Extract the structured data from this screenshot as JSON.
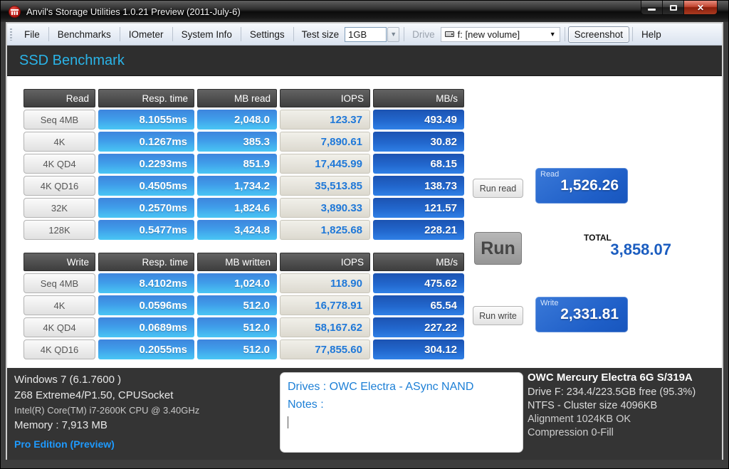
{
  "window": {
    "title": "Anvil's Storage Utilities 1.0.21 Preview (2011-July-6)"
  },
  "menu": {
    "items": [
      "File",
      "Benchmarks",
      "IOmeter",
      "System Info",
      "Settings"
    ],
    "test_size_label": "Test size",
    "test_size_value": "1GB",
    "drive_label": "Drive",
    "drive_value": "f: [new volume]",
    "screenshot_label": "Screenshot",
    "help_label": "Help"
  },
  "banner": {
    "title": "SSD Benchmark"
  },
  "read_table": {
    "headers": [
      "Read",
      "Resp. time",
      "MB read",
      "IOPS",
      "MB/s"
    ],
    "rows": [
      [
        "Seq 4MB",
        "8.1055ms",
        "2,048.0",
        "123.37",
        "493.49"
      ],
      [
        "4K",
        "0.1267ms",
        "385.3",
        "7,890.61",
        "30.82"
      ],
      [
        "4K QD4",
        "0.2293ms",
        "851.9",
        "17,445.99",
        "68.15"
      ],
      [
        "4K QD16",
        "0.4505ms",
        "1,734.2",
        "35,513.85",
        "138.73"
      ],
      [
        "32K",
        "0.2570ms",
        "1,824.6",
        "3,890.33",
        "121.57"
      ],
      [
        "128K",
        "0.5477ms",
        "3,424.8",
        "1,825.68",
        "228.21"
      ]
    ]
  },
  "write_table": {
    "headers": [
      "Write",
      "Resp. time",
      "MB written",
      "IOPS",
      "MB/s"
    ],
    "rows": [
      [
        "Seq 4MB",
        "8.4102ms",
        "1,024.0",
        "118.90",
        "475.62"
      ],
      [
        "4K",
        "0.0596ms",
        "512.0",
        "16,778.91",
        "65.54"
      ],
      [
        "4K QD4",
        "0.0689ms",
        "512.0",
        "58,167.62",
        "227.22"
      ],
      [
        "4K QD16",
        "0.2055ms",
        "512.0",
        "77,855.60",
        "304.12"
      ]
    ]
  },
  "actions": {
    "run_read": "Run read",
    "run": "Run",
    "run_write": "Run write"
  },
  "scores": {
    "read_label": "Read",
    "read_value": "1,526.26",
    "total_label": "TOTAL",
    "total_value": "3,858.07",
    "write_label": "Write",
    "write_value": "2,331.81"
  },
  "footer": {
    "system": {
      "os": "Windows 7 (6.1.7600 )",
      "board": "Z68 Extreme4/P1.50, CPUSocket",
      "cpu": "Intel(R) Core(TM) i7-2600K CPU @ 3.40GHz",
      "memory": "Memory : 7,913 MB",
      "edition": "Pro Edition (Preview)"
    },
    "notes": {
      "drives_line": "Drives : OWC Electra - ASync NAND",
      "notes_line": "Notes :"
    },
    "drive": {
      "model": "OWC Mercury Electra 6G S/319A",
      "capacity": "Drive F: 234.4/223.5GB free (95.3%)",
      "filesystem": "NTFS - Cluster size 4096KB",
      "alignment": "Alignment 1024KB OK",
      "compression": "Compression 0-Fill"
    }
  },
  "colors": {
    "banner_accent": "#2ab4e8",
    "cell_blue_top": "#3e85dd",
    "cell_blue_bottom": "#49c6f4",
    "mbs_blue": "#1c53b2",
    "iops_text_blue": "#1f78d8",
    "total_orange": "#f9a21c",
    "score_value_blue": "#1b5dc0",
    "edition_blue": "#1e9aff"
  }
}
